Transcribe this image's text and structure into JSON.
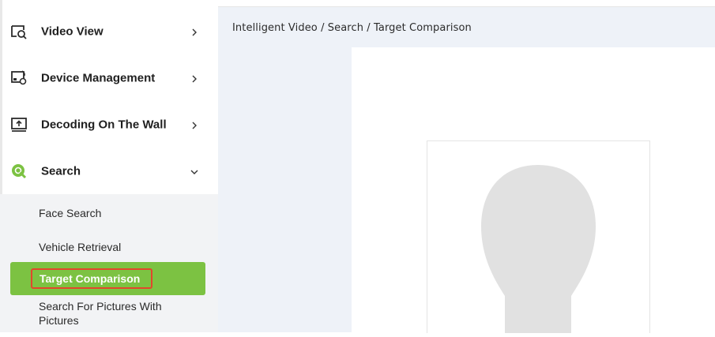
{
  "sidebar": {
    "items": [
      {
        "label": "Video View",
        "icon": "video-view-icon"
      },
      {
        "label": "Device Management",
        "icon": "device-management-icon"
      },
      {
        "label": "Decoding On The Wall",
        "icon": "decoding-wall-icon"
      },
      {
        "label": "Search",
        "icon": "search-icon"
      }
    ],
    "search_submenu": [
      {
        "label": "Face Search"
      },
      {
        "label": "Vehicle Retrieval"
      },
      {
        "label": "Target Comparison"
      },
      {
        "label": "Search For Pictures With Pictures"
      }
    ]
  },
  "breadcrumb": "Intelligent Video / Search / Target Comparison",
  "colors": {
    "accent": "#7cc242",
    "highlight_border": "#e2472c",
    "main_background": "#eef2f8",
    "submenu_background": "#f2f3f5"
  }
}
